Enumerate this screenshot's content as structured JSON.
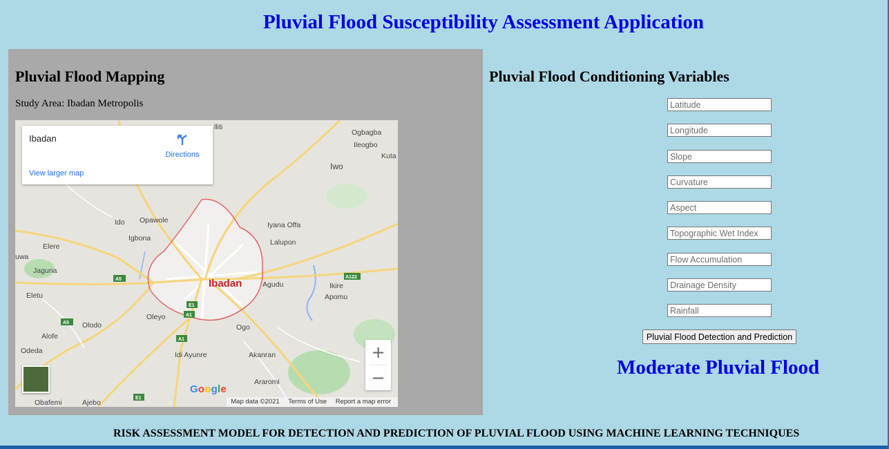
{
  "app": {
    "title": "Pluvial Flood Susceptibility Assessment Application",
    "footer": "RISK ASSESSMENT MODEL FOR DETECTION AND PREDICTION OF PLUVIAL FLOOD USING MACHINE LEARNING TECHNIQUES"
  },
  "mapping": {
    "heading": "Pluvial Flood Mapping",
    "study_area": "Study Area: Ibadan Metropolis"
  },
  "map": {
    "place_name": "Ibadan",
    "directions_label": "Directions",
    "view_larger_label": "View larger map",
    "zoom_in": "+",
    "zoom_out": "−",
    "google_logo": [
      "G",
      "o",
      "o",
      "g",
      "l",
      "e"
    ],
    "logo_colors": [
      "#4285f4",
      "#ea4335",
      "#fbbc05",
      "#4285f4",
      "#34a853",
      "#ea4335"
    ],
    "attribution": {
      "data": "Map data ©2021",
      "terms": "Terms of Use",
      "report": "Report a map error"
    },
    "city_label": "Ibadan",
    "labels": [
      "Ogbagba",
      "Ileogbo",
      "Kuta",
      "Iwo",
      "lliti",
      "Ido",
      "Opawole",
      "Iyana Offa",
      "Igbona",
      "Lalupon",
      "Elere",
      "uwa",
      "Jaguna",
      "Agudu",
      "Ikire",
      "Apomu",
      "Eletu",
      "Oleyo",
      "Olodo",
      "Alofe",
      "Ogo",
      "Odeda",
      "Idi Ayunre",
      "Akanran",
      "Araromi",
      "Obafemi",
      "Ajebo"
    ],
    "road_shields": [
      "A5",
      "A122",
      "E1",
      "A1",
      "A5",
      "A1",
      "E1"
    ],
    "colors": {
      "land": "#e6e4df",
      "urban": "#f1f0ee",
      "boundary": "#e06666",
      "road": "#f6d57a",
      "water": "#8ab4f8",
      "park": "#b7dcb0"
    }
  },
  "variables": {
    "heading": "Pluvial Flood Conditioning Variables",
    "fields": [
      {
        "placeholder": "Latitude",
        "value": ""
      },
      {
        "placeholder": "Longitude",
        "value": ""
      },
      {
        "placeholder": "Slope",
        "value": ""
      },
      {
        "placeholder": "Curvature",
        "value": ""
      },
      {
        "placeholder": "Aspect",
        "value": ""
      },
      {
        "placeholder": "Topographic Wet Index",
        "value": ""
      },
      {
        "placeholder": "Flow Accumulation",
        "value": ""
      },
      {
        "placeholder": "Drainage Density",
        "value": ""
      },
      {
        "placeholder": "Rainfall",
        "value": ""
      }
    ],
    "button_label": "Pluvial Flood Detection and Prediction",
    "result": "Moderate Pluvial Flood"
  },
  "theme": {
    "background": "#add8e6",
    "panel": "#a9a9a9",
    "accent": "#0000e6"
  }
}
